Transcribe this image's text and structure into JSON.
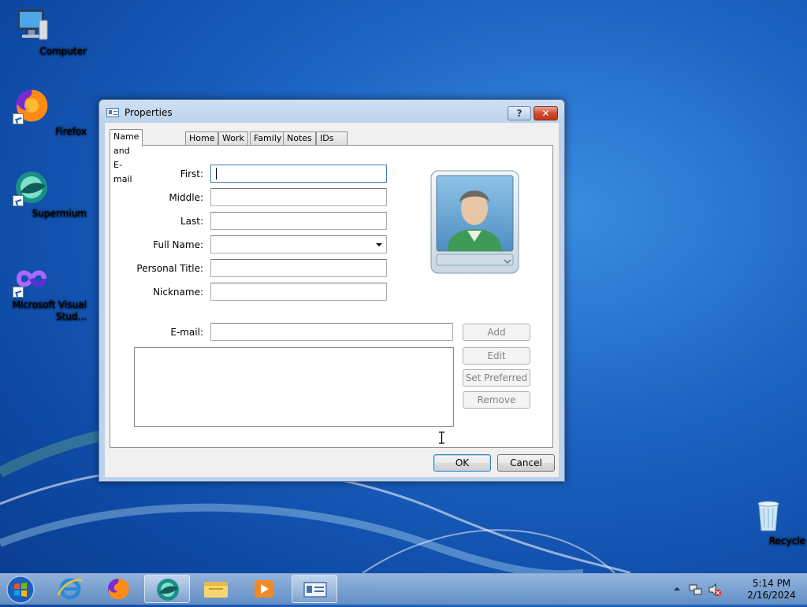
{
  "desktop": {
    "icons": [
      {
        "label": "Computer"
      },
      {
        "label": "Firefox"
      },
      {
        "label": "Supermium"
      },
      {
        "label": "Microsoft Visual Stud..."
      },
      {
        "label": "Recycle Bin"
      }
    ]
  },
  "dialog": {
    "title": "Properties",
    "help_label": "?",
    "close_label": "✕",
    "tabs": [
      "Name and E-mail",
      "Home",
      "Work",
      "Family",
      "Notes",
      "IDs"
    ],
    "active_tab": "Name and E-mail",
    "fields": {
      "first_label": "First:",
      "first_value": "",
      "middle_label": "Middle:",
      "middle_value": "",
      "last_label": "Last:",
      "last_value": "",
      "fullname_label": "Full Name:",
      "fullname_value": "",
      "personal_title_label": "Personal Title:",
      "personal_title_value": "",
      "nickname_label": "Nickname:",
      "nickname_value": "",
      "email_label": "E-mail:",
      "email_value": ""
    },
    "buttons": {
      "add": "Add",
      "edit": "Edit",
      "set_preferred": "Set Preferred",
      "remove": "Remove",
      "ok": "OK",
      "cancel": "Cancel"
    }
  },
  "taskbar": {
    "clock_time": "5:14 PM",
    "clock_date": "2/16/2024"
  },
  "colors": {
    "desktop_blue": "#1c63c2",
    "accent": "#3c7fb1",
    "close_red": "#c23616"
  }
}
